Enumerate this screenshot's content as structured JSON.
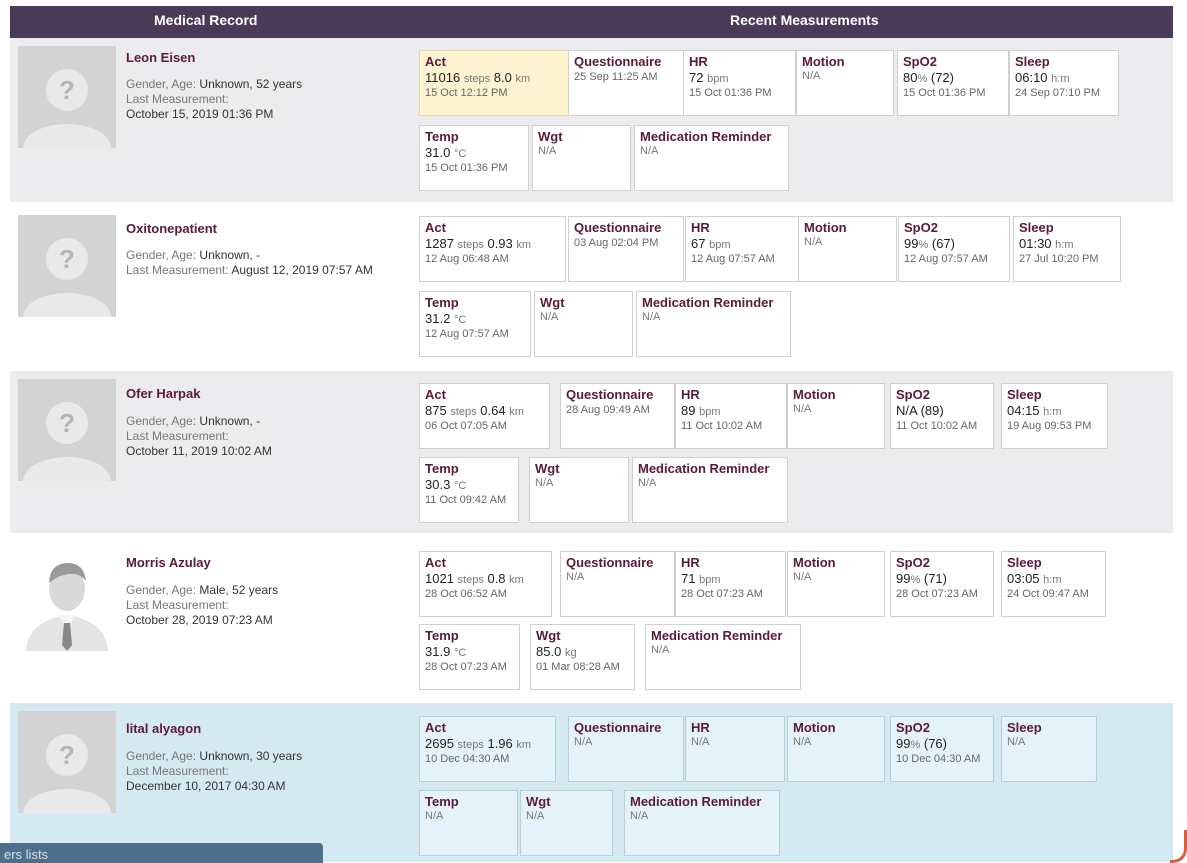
{
  "header": {
    "medical_record": "Medical Record",
    "recent_measurements": "Recent Measurements"
  },
  "labels": {
    "gender_age": "Gender, Age:",
    "last_measurement": "Last Measurement:"
  },
  "patients": [
    {
      "name": "Leon Eisen",
      "gender_age": "Unknown, 52 years",
      "last_measurement": "October 15, 2019 01:36 PM",
      "avatar": "placeholder-icon",
      "act": {
        "title": "Act",
        "steps": "11016",
        "steps_unit": "steps",
        "km": "8.0",
        "km_unit": "km",
        "date": "15 Oct 12:12 PM"
      },
      "questionnaire": {
        "title": "Questionnaire",
        "date": "25 Sep 11:25 AM"
      },
      "hr": {
        "title": "HR",
        "value": "72",
        "unit": "bpm",
        "date": "15 Oct 01:36 PM"
      },
      "motion": {
        "title": "Motion",
        "value": "N/A"
      },
      "spo2": {
        "title": "SpO2",
        "value": "80",
        "unit": "%",
        "extra": "(72)",
        "date": "15 Oct 01:36 PM"
      },
      "sleep": {
        "title": "Sleep",
        "value": "06:10",
        "unit": "h:m",
        "date": "24 Sep 07:10 PM"
      },
      "temp": {
        "title": "Temp",
        "value": "31.0",
        "unit": "°C",
        "date": "15 Oct 01:36 PM"
      },
      "wgt": {
        "title": "Wgt",
        "value": "N/A"
      },
      "med": {
        "title": "Medication Reminder",
        "value": "N/A"
      }
    },
    {
      "name": "Oxitonepatient",
      "gender_age": "Unknown, -",
      "last_measurement": "August 12, 2019 07:57 AM",
      "avatar": "placeholder-icon",
      "act": {
        "title": "Act",
        "steps": "1287",
        "steps_unit": "steps",
        "km": "0.93",
        "km_unit": "km",
        "date": "12 Aug 06:48 AM"
      },
      "questionnaire": {
        "title": "Questionnaire",
        "date": "03 Aug 02:04 PM"
      },
      "hr": {
        "title": "HR",
        "value": "67",
        "unit": "bpm",
        "date": "12 Aug 07:57 AM"
      },
      "motion": {
        "title": "Motion",
        "value": "N/A"
      },
      "spo2": {
        "title": "SpO2",
        "value": "99",
        "unit": "%",
        "extra": "(67)",
        "date": "12 Aug 07:57 AM"
      },
      "sleep": {
        "title": "Sleep",
        "value": "01:30",
        "unit": "h:m",
        "date": "27 Jul 10:20 PM"
      },
      "temp": {
        "title": "Temp",
        "value": "31.2",
        "unit": "°C",
        "date": "12 Aug 07:57 AM"
      },
      "wgt": {
        "title": "Wgt",
        "value": "N/A"
      },
      "med": {
        "title": "Medication Reminder",
        "value": "N/A"
      }
    },
    {
      "name": "Ofer Harpak",
      "gender_age": "Unknown, -",
      "last_measurement": "October 11, 2019 10:02 AM",
      "avatar": "placeholder-icon",
      "act": {
        "title": "Act",
        "steps": "875",
        "steps_unit": "steps",
        "km": "0.64",
        "km_unit": "km",
        "date": "06 Oct 07:05 AM"
      },
      "questionnaire": {
        "title": "Questionnaire",
        "date": "28 Aug 09:49 AM"
      },
      "hr": {
        "title": "HR",
        "value": "89",
        "unit": "bpm",
        "date": "11 Oct 10:02 AM"
      },
      "motion": {
        "title": "Motion",
        "value": "N/A"
      },
      "spo2": {
        "title": "SpO2",
        "value": "N/A",
        "unit": "",
        "extra": "(89)",
        "date": "11 Oct 10:02 AM"
      },
      "sleep": {
        "title": "Sleep",
        "value": "04:15",
        "unit": "h:m",
        "date": "19 Aug 09:53 PM"
      },
      "temp": {
        "title": "Temp",
        "value": "30.3",
        "unit": "°C",
        "date": "11 Oct 09:42 AM"
      },
      "wgt": {
        "title": "Wgt",
        "value": "N/A"
      },
      "med": {
        "title": "Medication Reminder",
        "value": "N/A"
      }
    },
    {
      "name": "Morris Azulay",
      "gender_age": "Male, 52 years",
      "last_measurement": "October 28, 2019 07:23 AM",
      "avatar": "male-avatar-icon",
      "act": {
        "title": "Act",
        "steps": "1021",
        "steps_unit": "steps",
        "km": "0.8",
        "km_unit": "km",
        "date": "28 Oct 06:52 AM"
      },
      "questionnaire": {
        "title": "Questionnaire",
        "date": "N/A"
      },
      "hr": {
        "title": "HR",
        "value": "71",
        "unit": "bpm",
        "date": "28 Oct 07:23 AM"
      },
      "motion": {
        "title": "Motion",
        "value": "N/A"
      },
      "spo2": {
        "title": "SpO2",
        "value": "99",
        "unit": "%",
        "extra": "(71)",
        "date": "28 Oct 07:23 AM"
      },
      "sleep": {
        "title": "Sleep",
        "value": "03:05",
        "unit": "h:m",
        "date": "24 Oct 09:47 AM"
      },
      "temp": {
        "title": "Temp",
        "value": "31.9",
        "unit": "°C",
        "date": "28 Oct 07:23 AM"
      },
      "wgt": {
        "title": "Wgt",
        "value": "85.0",
        "unit": "kg",
        "date": "01 Mar 08:28 AM"
      },
      "med": {
        "title": "Medication Reminder",
        "value": "N/A"
      }
    },
    {
      "name": "lital alyagon",
      "gender_age": "Unknown, 30 years",
      "last_measurement": "December 10, 2017 04:30 AM",
      "avatar": "placeholder-icon",
      "act": {
        "title": "Act",
        "steps": "2695",
        "steps_unit": "steps",
        "km": "1.96",
        "km_unit": "km",
        "date": "10 Dec 04:30 AM"
      },
      "questionnaire": {
        "title": "Questionnaire",
        "date": "N/A"
      },
      "hr": {
        "title": "HR",
        "value": "N/A"
      },
      "motion": {
        "title": "Motion",
        "value": "N/A"
      },
      "spo2": {
        "title": "SpO2",
        "value": "99",
        "unit": "%",
        "extra": "(76)",
        "date": "10 Dec 04:30 AM"
      },
      "sleep": {
        "title": "Sleep",
        "value": "N/A"
      },
      "temp": {
        "title": "Temp",
        "value": "N/A"
      },
      "wgt": {
        "title": "Wgt",
        "value": "N/A"
      },
      "med": {
        "title": "Medication Reminder",
        "value": "N/A"
      }
    }
  ],
  "bottom_tab": {
    "label": "ers lists"
  },
  "colors": {
    "header_bg": "#4a3a57",
    "row_alt": "#ececee",
    "row_selected": "#d5e9f3",
    "act_highlight": "#fdf3d0",
    "title": "#5a1a3a"
  }
}
